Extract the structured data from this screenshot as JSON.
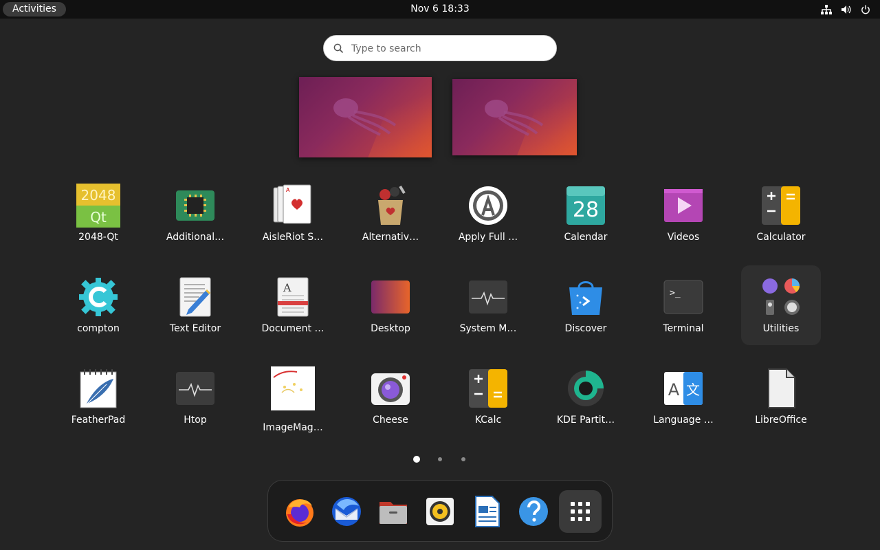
{
  "topbar": {
    "activities_label": "Activities",
    "clock": "Nov 6  18:33",
    "tray_icons": [
      "network-icon",
      "volume-icon",
      "power-icon"
    ]
  },
  "search": {
    "placeholder": "Type to search"
  },
  "apps": [
    {
      "label": "2048-Qt",
      "icon": "2048-icon"
    },
    {
      "label": "Additional…",
      "icon": "chip-icon"
    },
    {
      "label": "AisleRiot S…",
      "icon": "cards-icon"
    },
    {
      "label": "Alternativ…",
      "icon": "bag-icon"
    },
    {
      "label": "Apply Full …",
      "icon": "apply-icon"
    },
    {
      "label": "Calendar",
      "icon": "calendar-icon",
      "day": "28"
    },
    {
      "label": "Videos",
      "icon": "videos-icon"
    },
    {
      "label": "Calculator",
      "icon": "calculator-icon"
    },
    {
      "label": "compton",
      "icon": "gear-c-icon"
    },
    {
      "label": "Text Editor",
      "icon": "text-editor-icon"
    },
    {
      "label": "Document …",
      "icon": "document-icon"
    },
    {
      "label": "Desktop",
      "icon": "desktop-icon"
    },
    {
      "label": "System M…",
      "icon": "system-monitor-icon"
    },
    {
      "label": "Discover",
      "icon": "discover-icon"
    },
    {
      "label": "Terminal",
      "icon": "terminal-icon",
      "prompt": ">_"
    },
    {
      "label": "Utilities",
      "icon": "folder-icon"
    },
    {
      "label": "FeatherPad",
      "icon": "featherpad-icon"
    },
    {
      "label": "Htop",
      "icon": "htop-icon"
    },
    {
      "label": "ImageMag…",
      "icon": "imagemagick-icon"
    },
    {
      "label": "Cheese",
      "icon": "cheese-icon"
    },
    {
      "label": "KCalc",
      "icon": "kcalc-icon"
    },
    {
      "label": "KDE Partit…",
      "icon": "partition-icon"
    },
    {
      "label": "Language …",
      "icon": "language-icon",
      "glyph_a": "A",
      "glyph_b": "文"
    },
    {
      "label": "LibreOffice",
      "icon": "libreoffice-icon"
    }
  ],
  "pages": {
    "count": 3,
    "current": 1
  },
  "dock": [
    {
      "name": "firefox",
      "icon": "firefox-icon"
    },
    {
      "name": "thunderbird",
      "icon": "thunderbird-icon"
    },
    {
      "name": "files",
      "icon": "files-icon"
    },
    {
      "name": "rhythmbox",
      "icon": "rhythmbox-icon"
    },
    {
      "name": "writer",
      "icon": "writer-icon"
    },
    {
      "name": "help",
      "icon": "help-icon"
    },
    {
      "name": "show-apps",
      "icon": "app-grid-icon"
    }
  ],
  "colors": {
    "background": "#242424",
    "topbar": "#111111",
    "accent": "#e95420"
  }
}
